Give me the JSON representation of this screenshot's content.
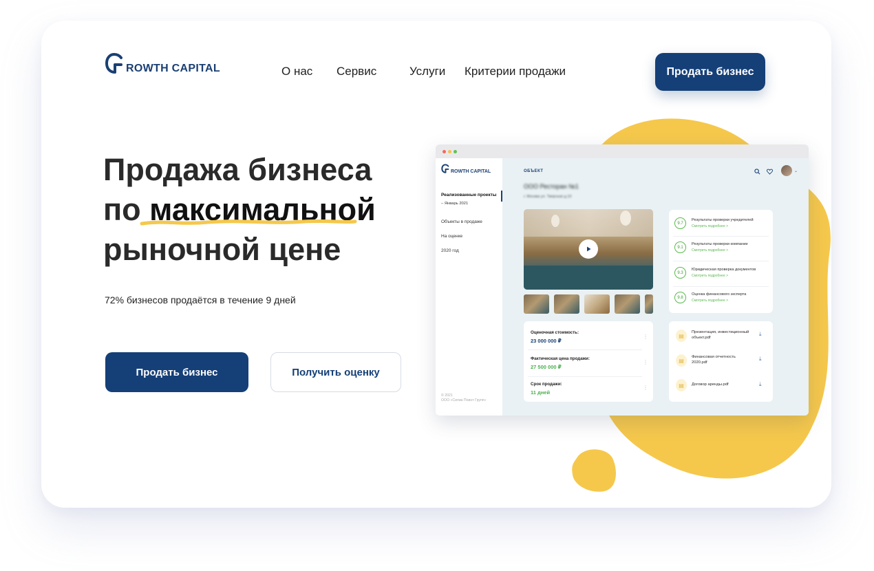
{
  "brand": {
    "logo_letter": "G",
    "logo_rest": "ROWTH CAPITAL"
  },
  "nav": {
    "items": [
      "О нас",
      "Сервис",
      "Услуги",
      "Критерии продажи"
    ]
  },
  "header": {
    "cta": "Продать бизнес"
  },
  "hero": {
    "line1": "Продажа бизнеса",
    "line2_prefix": "по ",
    "line2_highlight": "максимальной",
    "line3": "рыночной цене",
    "subtitle": "72% бизнесов продаётся в течение 9 дней",
    "btn_primary": "Продать бизнес",
    "btn_secondary": "Получить оценку"
  },
  "mockup": {
    "logo_letter": "G",
    "logo_rest": "ROWTH CAPITAL",
    "sidebar": {
      "active": "Реализованные проекты",
      "active_sub": "– Январь 2021",
      "items": [
        "Объекты в продаже",
        "На оценке",
        "2020 год"
      ],
      "copyright_1": "© 2021",
      "copyright_2": "ООО «Сигма Поинт Групп»"
    },
    "breadcrumb": "ОБЪЕКТ",
    "title": "ООО Ресторан №1",
    "address": "г. Москва ул. Тверская д.10",
    "checks": [
      {
        "score": "9.7",
        "title": "Результаты проверки учредителей",
        "link": "Смотреть подробнее >"
      },
      {
        "score": "9.1",
        "title": "Результаты проверки компании",
        "link": "Смотреть подробнее >"
      },
      {
        "score": "9.3",
        "title": "Юридическая проверка документов",
        "link": "Смотреть подробнее >"
      },
      {
        "score": "9.8",
        "title": "Оценка финансового эксперта",
        "link": "Смотреть подробнее >"
      }
    ],
    "prices": [
      {
        "label": "Оценочная стоимость:",
        "value": "23 000 000 ₽",
        "color": "#1a3f73"
      },
      {
        "label": "Фактическая цена продажи:",
        "value": "27 500 000 ₽",
        "color": "#4caf50"
      },
      {
        "label": "Срок продажи:",
        "value": "11 дней",
        "color": "#4caf50"
      }
    ],
    "docs": [
      {
        "line1": "Презентация, инвестиционный",
        "line2": "объект.pdf"
      },
      {
        "line1": "Финансовая отчетность",
        "line2": "2020.pdf"
      },
      {
        "line1": "Договор аренды.pdf",
        "line2": ""
      }
    ],
    "icons": [
      "search-icon",
      "heart-icon",
      "chevron-down-icon",
      "play-icon",
      "document-icon",
      "download-icon",
      "kebab-icon"
    ]
  },
  "colors": {
    "brand": "#153f77",
    "accent": "#f5c84c",
    "success": "#4caf50"
  }
}
